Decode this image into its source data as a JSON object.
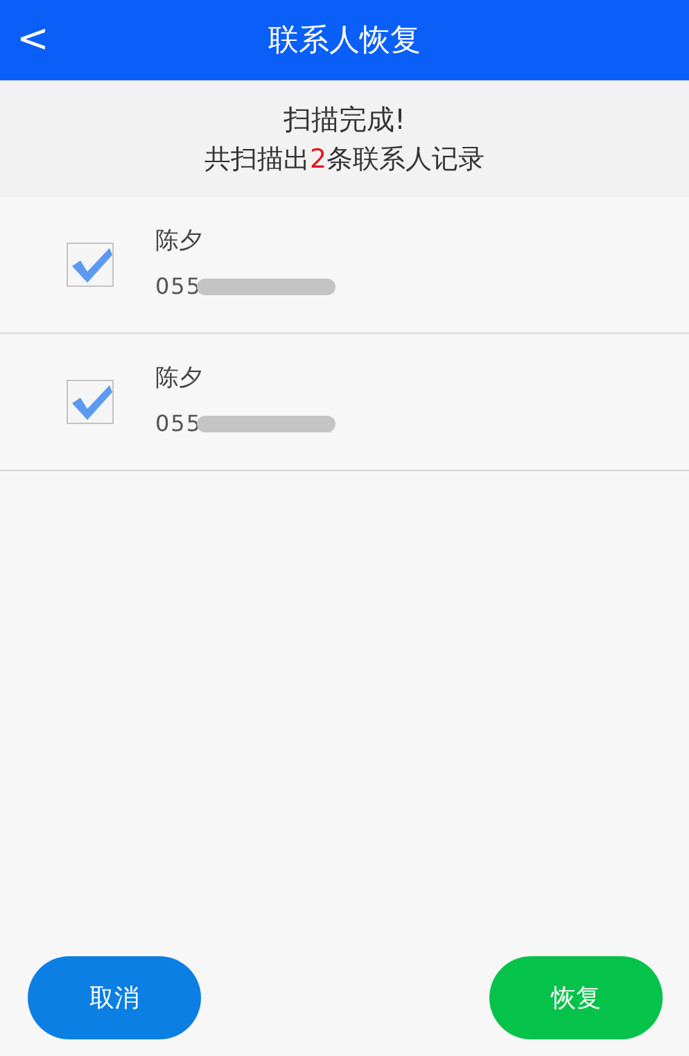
{
  "header": {
    "back_icon": "<",
    "title": "联系人恢复"
  },
  "summary": {
    "status": "扫描完成!",
    "count_prefix": "共扫描出",
    "count": "2",
    "count_suffix": "条联系人记录"
  },
  "contacts": [
    {
      "name": "陈夕",
      "phone": "055",
      "checked": true
    },
    {
      "name": "陈夕",
      "phone": "055",
      "checked": true
    }
  ],
  "buttons": [
    {
      "kind": "cancel",
      "label": "取消"
    },
    {
      "kind": "confirm",
      "label": "恢复"
    }
  ]
}
